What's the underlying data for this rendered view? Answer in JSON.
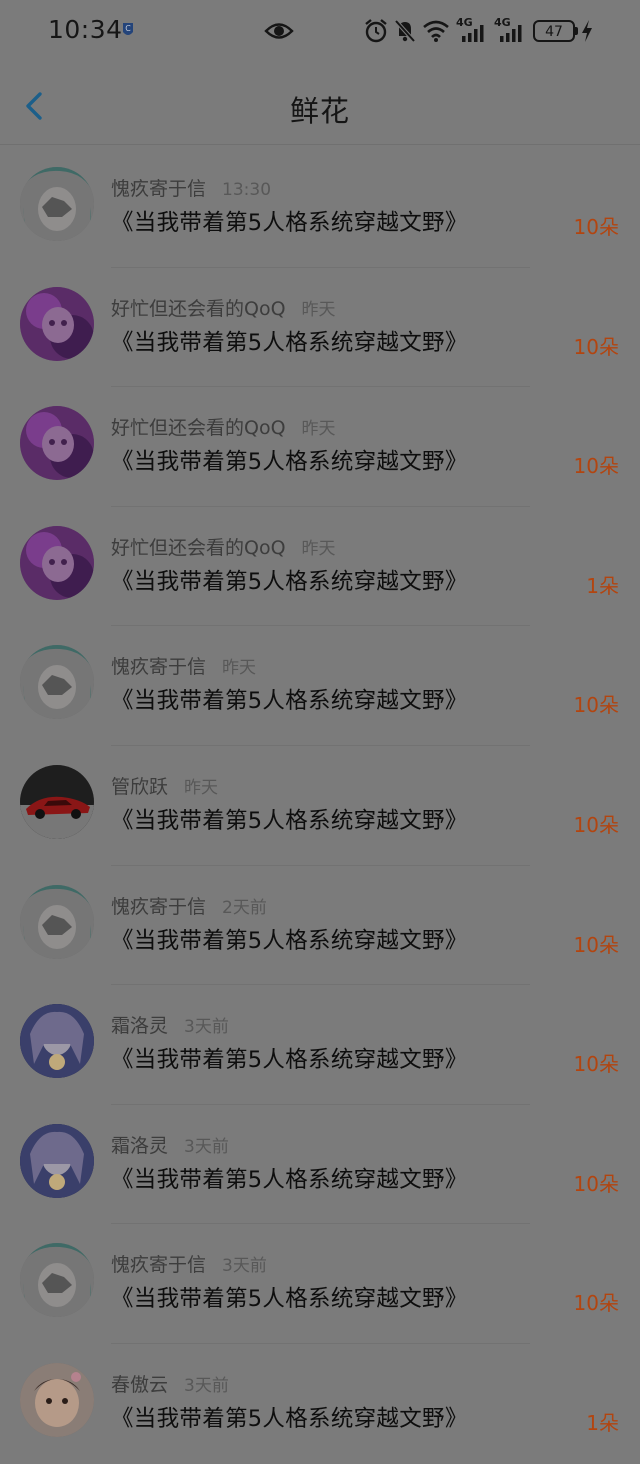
{
  "status_bar": {
    "time": "10:34",
    "battery_level": "47",
    "network_1": "4G",
    "network_2": "4G"
  },
  "header": {
    "title": "鲜花"
  },
  "records": [
    {
      "name": "愧疚寄于信",
      "time": "13:30",
      "message": "《当我带着第5人格系统穿越文野》",
      "amount": "10朵"
    },
    {
      "name": "好忙但还会看的QoQ",
      "time": "昨天",
      "message": "《当我带着第5人格系统穿越文野》",
      "amount": "10朵"
    },
    {
      "name": "好忙但还会看的QoQ",
      "time": "昨天",
      "message": "《当我带着第5人格系统穿越文野》",
      "amount": "10朵"
    },
    {
      "name": "好忙但还会看的QoQ",
      "time": "昨天",
      "message": "《当我带着第5人格系统穿越文野》",
      "amount": "1朵"
    },
    {
      "name": "愧疚寄于信",
      "time": "昨天",
      "message": "《当我带着第5人格系统穿越文野》",
      "amount": "10朵"
    },
    {
      "name": "管欣跃",
      "time": "昨天",
      "message": "《当我带着第5人格系统穿越文野》",
      "amount": "10朵"
    },
    {
      "name": "愧疚寄于信",
      "time": "2天前",
      "message": "《当我带着第5人格系统穿越文野》",
      "amount": "10朵"
    },
    {
      "name": "霜洛灵",
      "time": "3天前",
      "message": "《当我带着第5人格系统穿越文野》",
      "amount": "10朵"
    },
    {
      "name": "霜洛灵",
      "time": "3天前",
      "message": "《当我带着第5人格系统穿越文野》",
      "amount": "10朵"
    },
    {
      "name": "愧疚寄于信",
      "time": "3天前",
      "message": "《当我带着第5人格系统穿越文野》",
      "amount": "10朵"
    },
    {
      "name": "春傲云",
      "time": "3天前",
      "message": "《当我带着第5人格系统穿越文野》",
      "amount": "1朵"
    }
  ],
  "colors": {
    "accent_back": "#1c5f8a",
    "amount": "#b24510"
  }
}
